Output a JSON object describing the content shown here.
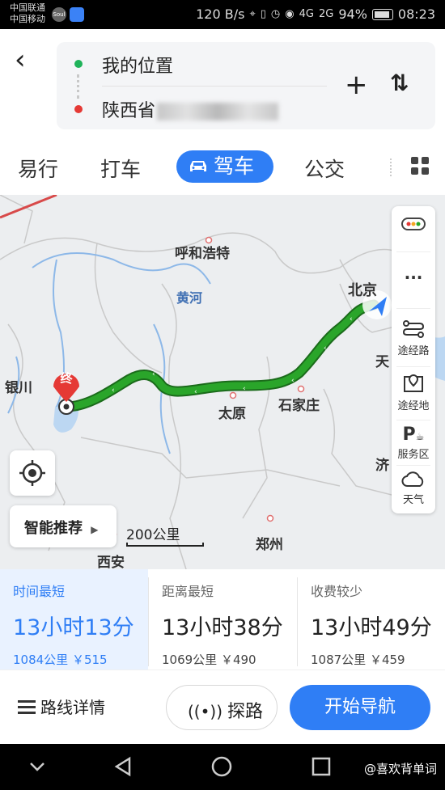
{
  "status_bar": {
    "carrier1": "中国联通",
    "carrier2": "中国移动",
    "soul_label": "Soul",
    "net_speed": "120 B/s",
    "signal1": "4G",
    "signal2": "2G",
    "battery": "94%",
    "time": "08:23"
  },
  "header": {
    "origin": "我的位置",
    "destination": "陕西省",
    "add_label": "+",
    "swap_label": "⇅"
  },
  "tabs": [
    {
      "label": "易行"
    },
    {
      "label": "打车"
    },
    {
      "label": "驾车"
    },
    {
      "label": "公交"
    }
  ],
  "map": {
    "cities": [
      "呼和浩特",
      "北京",
      "天",
      "银川",
      "太原",
      "石家庄",
      "济",
      "郑州",
      "西安"
    ],
    "river": "黄河",
    "end_marker": "终",
    "scale": "200公里",
    "smart_recommend": "智能推荐",
    "sidebar": {
      "more": "···",
      "waypoint_route": "途经路",
      "waypoint_place": "途经地",
      "service_area": "服务区",
      "weather": "天气"
    }
  },
  "routes": [
    {
      "label": "时间最短",
      "time": "13小时13分",
      "info": "1084公里 ￥515"
    },
    {
      "label": "距离最短",
      "time": "13小时38分",
      "info": "1069公里 ￥490"
    },
    {
      "label": "收费较少",
      "time": "13小时49分",
      "info": "1087公里 ￥459"
    }
  ],
  "actions": {
    "detail": "路线详情",
    "explore": "探路",
    "start": "开始导航"
  },
  "watermark": "@喜欢背单词",
  "colors": {
    "accent": "#2f7ef5",
    "route_green": "#2aa52a",
    "origin_dot": "#1fb35a",
    "dest_dot": "#e53935"
  }
}
